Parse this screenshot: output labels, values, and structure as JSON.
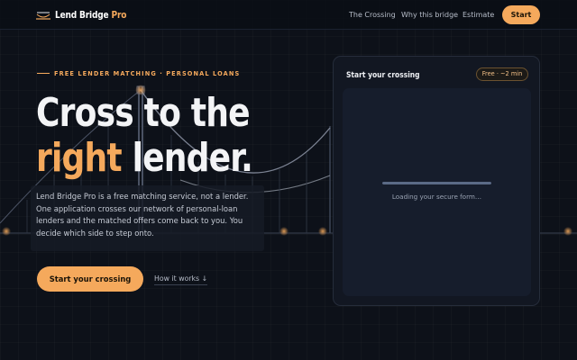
{
  "nav": {
    "brand": {
      "name": "Lend Bridge",
      "suffix": "Pro"
    },
    "links": [
      "The Crossing",
      "Why this bridge",
      "Estimate"
    ],
    "cta": "Start"
  },
  "hero": {
    "eyebrow": "FREE LENDER MATCHING · PERSONAL LOANS",
    "headline_line1": "Cross to the",
    "headline_accent": "right",
    "headline_line2_rest": "lender.",
    "lede": "Lend Bridge Pro is a free matching service, not a lender. One application crosses our network of personal-loan lenders and the matched offers come back to you. You decide which side to step onto.",
    "primary_cta": "Start your crossing",
    "secondary_link": "How it works ↓"
  },
  "card": {
    "title": "Start your crossing",
    "badge": "Free · ~2 min",
    "loading_text": "Loading your secure form…",
    "loading_progress": 1.0
  },
  "colors": {
    "accent": "#f5a95c",
    "background": "#0d1119",
    "card": "#121722"
  },
  "icons": {
    "brand": "bridge-icon"
  }
}
